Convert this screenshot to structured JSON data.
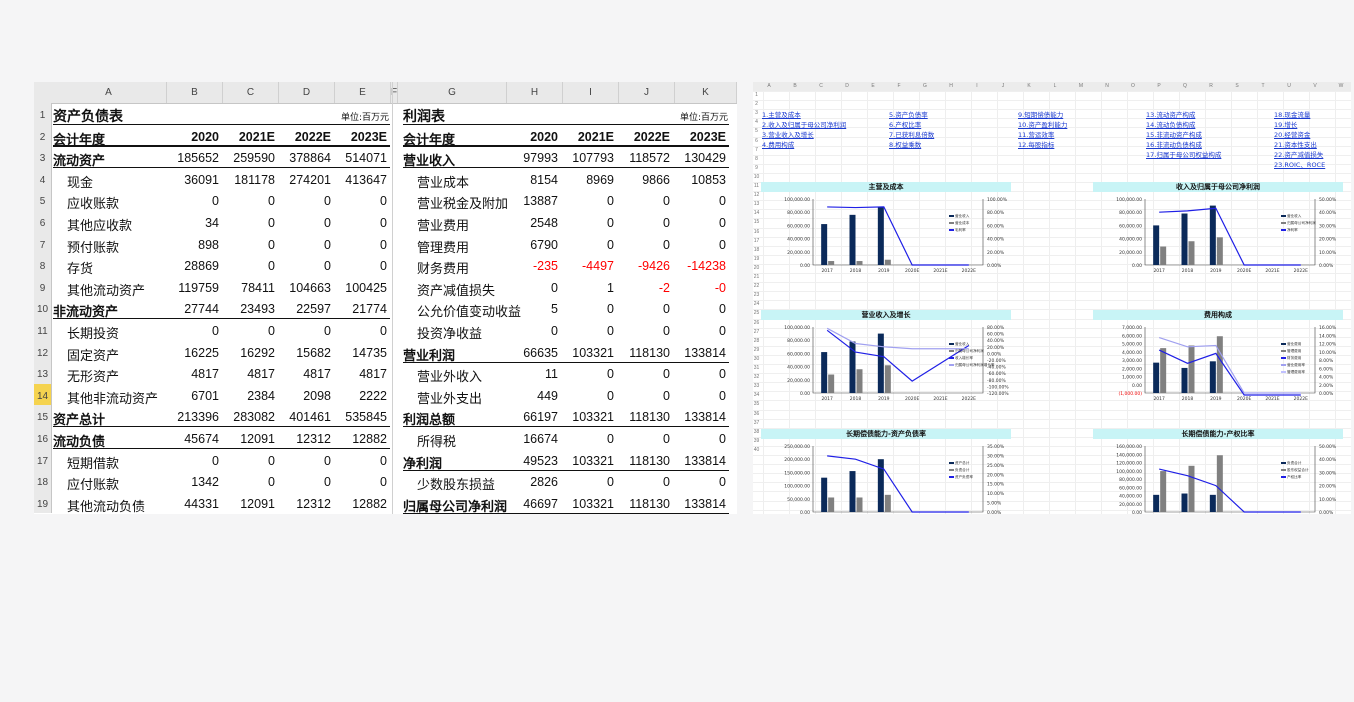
{
  "balance": {
    "title": "资产负债表",
    "unit": "单位:百万元",
    "header": {
      "label": "会计年度",
      "years": [
        "2020",
        "2021E",
        "2022E",
        "2023E"
      ]
    },
    "rows": [
      {
        "label": "流动资产",
        "values": [
          "185652",
          "259590",
          "378864",
          "514071"
        ],
        "bold": true
      },
      {
        "label": "现金",
        "values": [
          "36091",
          "181178",
          "274201",
          "413647"
        ]
      },
      {
        "label": "应收账款",
        "values": [
          "0",
          "0",
          "0",
          "0"
        ]
      },
      {
        "label": "其他应收款",
        "values": [
          "34",
          "0",
          "0",
          "0"
        ]
      },
      {
        "label": "预付账款",
        "values": [
          "898",
          "0",
          "0",
          "0"
        ]
      },
      {
        "label": "存货",
        "values": [
          "28869",
          "0",
          "0",
          "0"
        ]
      },
      {
        "label": "其他流动资产",
        "values": [
          "119759",
          "78411",
          "104663",
          "100425"
        ]
      },
      {
        "label": "非流动资产",
        "values": [
          "27744",
          "23493",
          "22597",
          "21774"
        ],
        "bold": true
      },
      {
        "label": "长期投资",
        "values": [
          "0",
          "0",
          "0",
          "0"
        ]
      },
      {
        "label": "固定资产",
        "values": [
          "16225",
          "16292",
          "15682",
          "14735"
        ]
      },
      {
        "label": "无形资产",
        "values": [
          "4817",
          "4817",
          "4817",
          "4817"
        ]
      },
      {
        "label": "其他非流动资产",
        "values": [
          "6701",
          "2384",
          "2098",
          "2222"
        ]
      },
      {
        "label": "资产总计",
        "values": [
          "213396",
          "283082",
          "401461",
          "535845"
        ],
        "bold": true
      },
      {
        "label": "流动负债",
        "values": [
          "45674",
          "12091",
          "12312",
          "12882"
        ],
        "bold": true
      },
      {
        "label": "短期借款",
        "values": [
          "0",
          "0",
          "0",
          "0"
        ]
      },
      {
        "label": "应付账款",
        "values": [
          "1342",
          "0",
          "0",
          "0"
        ]
      },
      {
        "label": "其他流动负债",
        "values": [
          "44331",
          "12091",
          "12312",
          "12882"
        ]
      }
    ]
  },
  "income": {
    "title": "利润表",
    "unit": "单位:百万元",
    "header": {
      "label": "会计年度",
      "years": [
        "2020",
        "2021E",
        "2022E",
        "2023E"
      ]
    },
    "rows": [
      {
        "label": "营业收入",
        "values": [
          "97993",
          "107793",
          "118572",
          "130429"
        ],
        "bold": true
      },
      {
        "label": "营业成本",
        "values": [
          "8154",
          "8969",
          "9866",
          "10853"
        ]
      },
      {
        "label": "营业税金及附加",
        "values": [
          "13887",
          "0",
          "0",
          "0"
        ]
      },
      {
        "label": "营业费用",
        "values": [
          "2548",
          "0",
          "0",
          "0"
        ]
      },
      {
        "label": "管理费用",
        "values": [
          "6790",
          "0",
          "0",
          "0"
        ]
      },
      {
        "label": "财务费用",
        "values": [
          "-235",
          "-4497",
          "-9426",
          "-14238"
        ],
        "neg": true
      },
      {
        "label": "资产减值损失",
        "values": [
          "0",
          "1",
          "-2",
          "-0"
        ],
        "negcols": [
          2,
          3
        ]
      },
      {
        "label": "公允价值变动收益",
        "values": [
          "5",
          "0",
          "0",
          "0"
        ]
      },
      {
        "label": "投资净收益",
        "values": [
          "0",
          "0",
          "0",
          "0"
        ]
      },
      {
        "label": "营业利润",
        "values": [
          "66635",
          "103321",
          "118130",
          "133814"
        ],
        "bold": true
      },
      {
        "label": "营业外收入",
        "values": [
          "11",
          "0",
          "0",
          "0"
        ]
      },
      {
        "label": "营业外支出",
        "values": [
          "449",
          "0",
          "0",
          "0"
        ]
      },
      {
        "label": "利润总额",
        "values": [
          "66197",
          "103321",
          "118130",
          "133814"
        ],
        "bold": true
      },
      {
        "label": "所得税",
        "values": [
          "16674",
          "0",
          "0",
          "0"
        ]
      },
      {
        "label": "净利润",
        "values": [
          "49523",
          "103321",
          "118130",
          "133814"
        ],
        "bold": true
      },
      {
        "label": "少数股东损益",
        "values": [
          "2826",
          "0",
          "0",
          "0"
        ]
      },
      {
        "label": "归属母公司净利润",
        "values": [
          "46697",
          "103321",
          "118130",
          "133814"
        ],
        "bold": true
      }
    ]
  },
  "sheet": {
    "columns": [
      "A",
      "B",
      "C",
      "D",
      "E",
      "F",
      "G",
      "H",
      "I",
      "J",
      "K"
    ],
    "row_numbers": [
      "1",
      "2",
      "3",
      "4",
      "5",
      "6",
      "7",
      "8",
      "9",
      "10",
      "11",
      "12",
      "13",
      "14",
      "15",
      "16",
      "17",
      "18",
      "19"
    ],
    "selected_row": "14"
  },
  "dashboard": {
    "columns": [
      "A",
      "B",
      "C",
      "D",
      "E",
      "F",
      "G",
      "H",
      "I",
      "J",
      "K",
      "L",
      "M",
      "N",
      "O",
      "P",
      "Q",
      "R",
      "S",
      "T",
      "U",
      "V",
      "W"
    ],
    "links": [
      "1.主营及成本",
      "2.收入及归属于母公司净利润",
      "3.营业收入及增长",
      "4.费用构成",
      "5.资产负债率",
      "6.产权比率",
      "7.已获利息倍数",
      "8.权益乘数",
      "9.短期偿债能力",
      "10.资产盈利能力",
      "11.营运效率",
      "12.每股指标",
      "13.流动资产构成",
      "14.流动负债构成",
      "15.非流动资产构成",
      "16.非流动负债构成",
      "17.归属于母公司权益构成",
      "18.现金流量",
      "19.增长",
      "20.经营资金",
      "21.资本性支出",
      "22.资产减值损失",
      "23.ROIC、ROCE"
    ],
    "charts": [
      {
        "title": "主营及成本",
        "yticks": [
          "100,000.00",
          "80,000.00",
          "60,000.00",
          "40,000.00",
          "20,000.00",
          "0.00"
        ],
        "rticks": [
          "100.00%",
          "80.00%",
          "60.00%",
          "40.00%",
          "20.00%",
          "0.00%"
        ],
        "legend": [
          "营业收入",
          "营业成本",
          "毛利率"
        ]
      },
      {
        "title": "收入及归属于母公司净利润",
        "yticks": [
          "100,000.00",
          "80,000.00",
          "60,000.00",
          "40,000.00",
          "20,000.00",
          "0.00"
        ],
        "rticks": [
          "50.00%",
          "40.00%",
          "30.00%",
          "20.00%",
          "10.00%",
          "0.00%"
        ],
        "legend": [
          "营业收入",
          "归属母公司净利润",
          "净利率"
        ]
      },
      {
        "title": "营业收入及增长",
        "yticks": [
          "100,000.00",
          "80,000.00",
          "60,000.00",
          "40,000.00",
          "20,000.00",
          "0.00"
        ],
        "rticks": [
          "80.00%",
          "60.00%",
          "40.00%",
          "20.00%",
          "0.00%",
          "-20.00%",
          "-40.00%",
          "-60.00%",
          "-80.00%",
          "-100.00%",
          "-120.00%"
        ],
        "legend": [
          "营业收入",
          "归属母公司净利润",
          "收入增长率",
          "归属母公司净利润增长率"
        ]
      },
      {
        "title": "费用构成",
        "yticks": [
          "7,000.00",
          "6,000.00",
          "5,000.00",
          "4,000.00",
          "3,000.00",
          "2,000.00",
          "1,000.00",
          "0.00",
          "(1,000.00)"
        ],
        "rticks": [
          "16.00%",
          "14.00%",
          "12.00%",
          "10.00%",
          "8.00%",
          "6.00%",
          "4.00%",
          "2.00%",
          "0.00%"
        ],
        "legend": [
          "营业费用",
          "管理费用",
          "财务费用",
          "营业费用率",
          "管理费用率"
        ]
      },
      {
        "title": "长期偿债能力-资产负债率",
        "yticks": [
          "250,000.00",
          "200,000.00",
          "150,000.00",
          "100,000.00",
          "50,000.00",
          "0.00"
        ],
        "rticks": [
          "35.00%",
          "30.00%",
          "25.00%",
          "20.00%",
          "15.00%",
          "10.00%",
          "5.00%",
          "0.00%"
        ],
        "legend": [
          "资产总计",
          "负债合计",
          "资产负债率"
        ]
      },
      {
        "title": "长期偿债能力-产权比率",
        "yticks": [
          "160,000.00",
          "140,000.00",
          "120,000.00",
          "100,000.00",
          "80,000.00",
          "60,000.00",
          "40,000.00",
          "20,000.00",
          "0.00"
        ],
        "rticks": [
          "50.00%",
          "40.00%",
          "30.00%",
          "20.00%",
          "10.00%",
          "0.00%"
        ],
        "legend": [
          "负债合计",
          "股东权益合计",
          "产权比率"
        ]
      }
    ],
    "chart_years": [
      "2017",
      "2018",
      "2019",
      "2020E",
      "2021E",
      "2022E"
    ]
  }
}
